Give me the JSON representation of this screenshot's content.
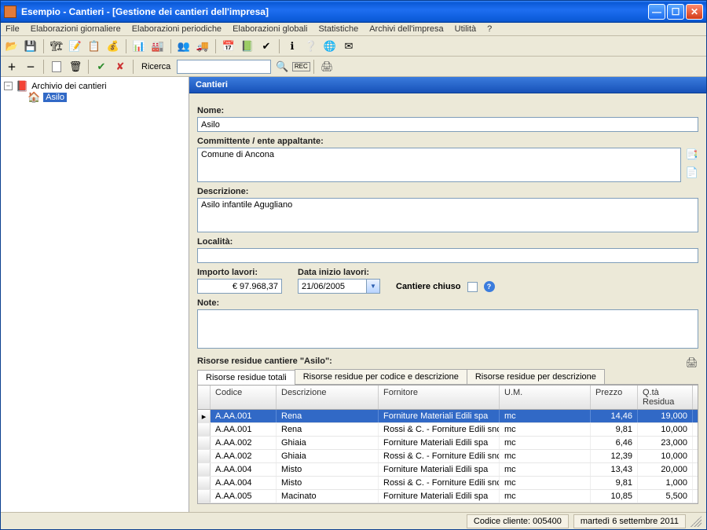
{
  "title": "Esempio - Cantieri - [Gestione dei cantieri dell'impresa]",
  "menu": [
    "File",
    "Elaborazioni giornaliere",
    "Elaborazioni periodiche",
    "Elaborazioni globali",
    "Statistiche",
    "Archivi dell'impresa",
    "Utilità",
    "?"
  ],
  "search_label": "Ricerca",
  "tree": {
    "root": "Archivio dei cantieri",
    "selected": "Asilo"
  },
  "panel_title": "Cantieri",
  "labels": {
    "nome": "Nome:",
    "committente": "Committente / ente appaltante:",
    "descrizione": "Descrizione:",
    "localita": "Località:",
    "importo": "Importo lavori:",
    "data_inizio": "Data inizio lavori:",
    "chiuso": "Cantiere chiuso",
    "note": "Note:"
  },
  "fields": {
    "nome": "Asilo",
    "committente": "Comune di Ancona",
    "descrizione": "Asilo infantile Agugliano",
    "localita": "",
    "importo": "€ 97.968,37",
    "data_inizio": "21/06/2005",
    "chiuso": false,
    "note": ""
  },
  "risorse_title": "Risorse residue cantiere \"Asilo\":",
  "tabs": [
    "Risorse residue totali",
    "Risorse residue per codice e descrizione",
    "Risorse residue per descrizione"
  ],
  "columns": [
    "Codice",
    "Descrizione",
    "Fornitore",
    "U.M.",
    "Prezzo",
    "Q.tà Residua"
  ],
  "rows": [
    {
      "cod": "A.AA.001",
      "desc": "Rena",
      "forn": "Forniture Materiali Edili spa",
      "um": "mc",
      "prezzo": "14,46",
      "qta": "19,000",
      "sel": true
    },
    {
      "cod": "A.AA.001",
      "desc": "Rena",
      "forn": "Rossi & C. - Forniture Edili snc",
      "um": "mc",
      "prezzo": "9,81",
      "qta": "10,000"
    },
    {
      "cod": "A.AA.002",
      "desc": "Ghiaia",
      "forn": "Forniture Materiali Edili spa",
      "um": "mc",
      "prezzo": "6,46",
      "qta": "23,000"
    },
    {
      "cod": "A.AA.002",
      "desc": "Ghiaia",
      "forn": "Rossi & C. - Forniture Edili snc",
      "um": "mc",
      "prezzo": "12,39",
      "qta": "10,000"
    },
    {
      "cod": "A.AA.004",
      "desc": "Misto",
      "forn": "Forniture Materiali Edili spa",
      "um": "mc",
      "prezzo": "13,43",
      "qta": "20,000"
    },
    {
      "cod": "A.AA.004",
      "desc": "Misto",
      "forn": "Rossi & C. - Forniture Edili snc",
      "um": "mc",
      "prezzo": "9,81",
      "qta": "1,000"
    },
    {
      "cod": "A.AA.005",
      "desc": "Macinato",
      "forn": "Forniture Materiali Edili spa",
      "um": "mc",
      "prezzo": "10,85",
      "qta": "5,500"
    }
  ],
  "status": {
    "codice": "Codice cliente: 005400",
    "data": "martedì 6 settembre 2011"
  }
}
